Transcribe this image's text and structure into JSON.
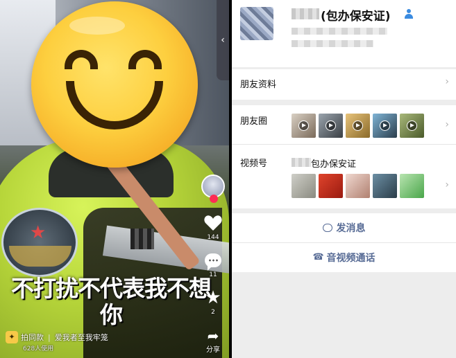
{
  "video": {
    "caption": "不打扰不代表我不想你",
    "side_actions": {
      "like_count": "144",
      "comment_count": "11",
      "favorite_count": "2",
      "share_label": "分享"
    },
    "template": {
      "label": "拍同款",
      "song": "爱我者至我牢笼",
      "uses": "628人使用"
    },
    "collapse_glyph": "‹"
  },
  "contact": {
    "name_suffix": "(包办保安证)",
    "rows": {
      "profile": "朋友资料",
      "moments": "朋友圈",
      "channels": "视频号"
    },
    "channel_name": "包办保安证",
    "chevron": "›",
    "actions": {
      "message": "发消息",
      "call": "音视频通话"
    },
    "colors": {
      "link_blue": "#576b95",
      "background": "#ededed"
    }
  }
}
